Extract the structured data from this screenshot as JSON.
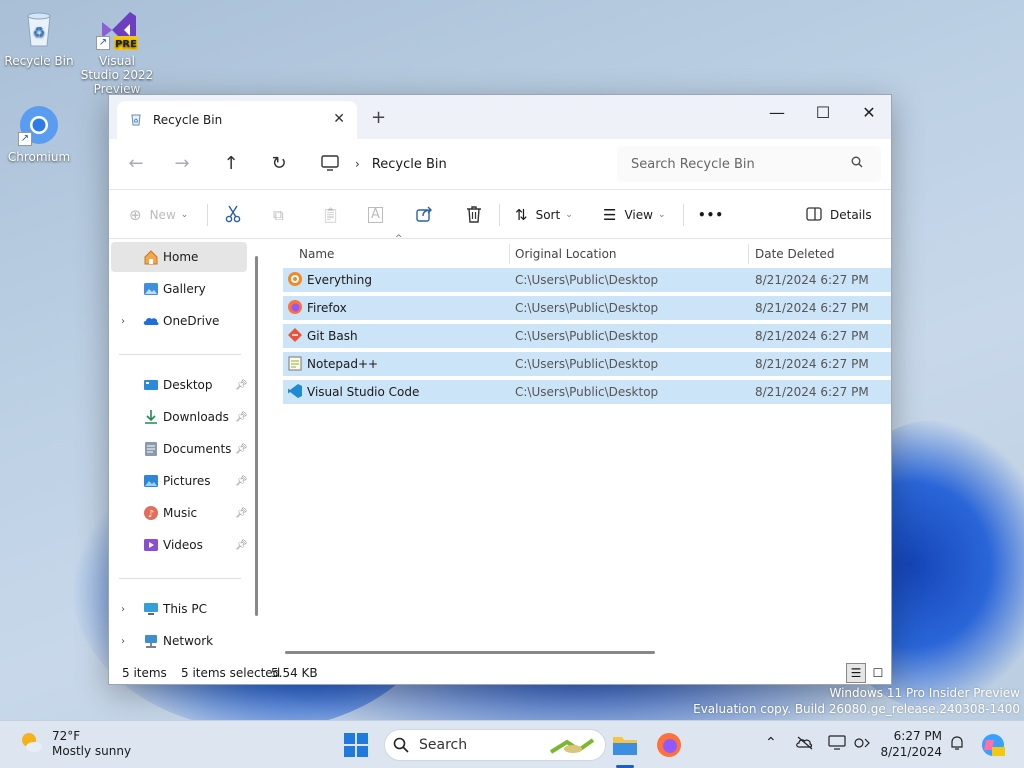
{
  "desktop": {
    "icons": [
      {
        "label": "Recycle Bin",
        "icon": "recycle-bin-icon"
      },
      {
        "label": "Visual Studio 2022 Preview",
        "icon": "visual-studio-icon",
        "badge": "PRE"
      },
      {
        "label": "Chromium",
        "icon": "chromium-icon"
      }
    ]
  },
  "window": {
    "tab_title": "Recycle Bin",
    "new_tab": "+",
    "controls": {
      "minimize": "—",
      "maximize": "☐",
      "close": "✕"
    },
    "address": {
      "location": "Recycle Bin"
    },
    "search_placeholder": "Search Recycle Bin",
    "toolbar": {
      "new_label": "New",
      "sort_label": "Sort",
      "view_label": "View",
      "more_label": "•••",
      "details_label": "Details"
    },
    "sidebar": {
      "items": [
        {
          "label": "Home",
          "icon": "home-icon",
          "active": true
        },
        {
          "label": "Gallery",
          "icon": "gallery-icon"
        },
        {
          "label": "OneDrive",
          "icon": "onedrive-icon",
          "expandable": true
        },
        {
          "label": "Desktop",
          "icon": "desktop-folder-icon",
          "pinned": true
        },
        {
          "label": "Downloads",
          "icon": "downloads-icon",
          "pinned": true
        },
        {
          "label": "Documents",
          "icon": "documents-icon",
          "pinned": true
        },
        {
          "label": "Pictures",
          "icon": "pictures-icon",
          "pinned": true
        },
        {
          "label": "Music",
          "icon": "music-icon",
          "pinned": true
        },
        {
          "label": "Videos",
          "icon": "videos-icon",
          "pinned": true
        },
        {
          "label": "This PC",
          "icon": "this-pc-icon",
          "expandable": true
        },
        {
          "label": "Network",
          "icon": "network-icon",
          "expandable": true
        }
      ]
    },
    "columns": {
      "name": "Name",
      "location": "Original Location",
      "date": "Date Deleted"
    },
    "files": [
      {
        "name": "Everything",
        "location": "C:\\Users\\Public\\Desktop",
        "date": "8/21/2024 6:27 PM",
        "icon": "everything-icon"
      },
      {
        "name": "Firefox",
        "location": "C:\\Users\\Public\\Desktop",
        "date": "8/21/2024 6:27 PM",
        "icon": "firefox-icon"
      },
      {
        "name": "Git Bash",
        "location": "C:\\Users\\Public\\Desktop",
        "date": "8/21/2024 6:27 PM",
        "icon": "git-bash-icon"
      },
      {
        "name": "Notepad++",
        "location": "C:\\Users\\Public\\Desktop",
        "date": "8/21/2024 6:27 PM",
        "icon": "notepadpp-icon"
      },
      {
        "name": "Visual Studio Code",
        "location": "C:\\Users\\Public\\Desktop",
        "date": "8/21/2024 6:27 PM",
        "icon": "vscode-icon"
      }
    ],
    "status": {
      "count": "5 items",
      "selected": "5 items selected",
      "size": "5.54 KB"
    }
  },
  "watermark": {
    "line1": "Windows 11 Pro Insider Preview",
    "line2": "Evaluation copy. Build 26080.ge_release.240308-1400"
  },
  "taskbar": {
    "weather": {
      "temp": "72°F",
      "condition": "Mostly sunny"
    },
    "search_label": "Search",
    "clock": {
      "time": "6:27 PM",
      "date": "8/21/2024"
    }
  },
  "colors": {
    "selection": "#cce4f7",
    "accent": "#1c5fc9",
    "taskbar": "#dde6f0"
  }
}
